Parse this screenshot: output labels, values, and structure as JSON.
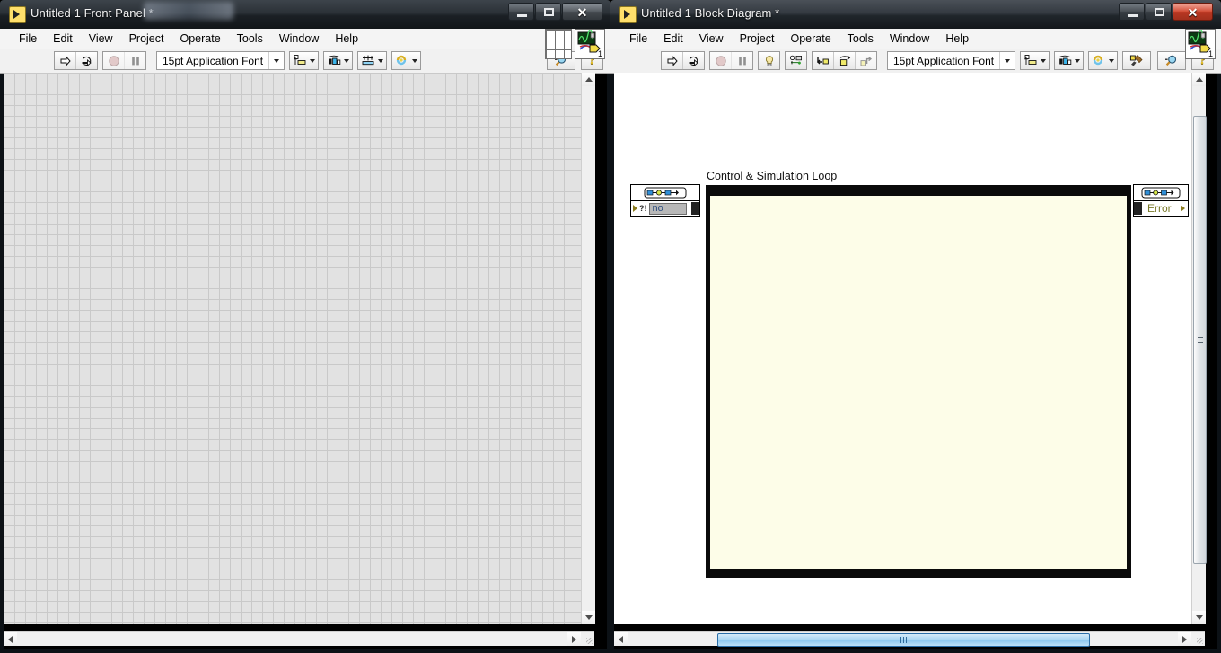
{
  "app": "LabVIEW",
  "windows": {
    "front_panel": {
      "title": "Untitled 1 Front Panel *",
      "active": false,
      "icon": "labview-vi-icon",
      "window_buttons": {
        "minimize": "–",
        "maximize": "□",
        "close": "✕"
      },
      "menus": [
        "File",
        "Edit",
        "View",
        "Project",
        "Operate",
        "Tools",
        "Window",
        "Help"
      ],
      "toolbar": {
        "font_selector": "15pt Application Font",
        "buttons": [
          {
            "name": "run-button",
            "icon": "run-arrow-icon",
            "enabled": true
          },
          {
            "name": "run-continuously-button",
            "icon": "run-continuously-icon",
            "enabled": true
          },
          {
            "name": "abort-execution-button",
            "icon": "abort-stop-icon",
            "enabled": false
          },
          {
            "name": "pause-button",
            "icon": "pause-icon",
            "enabled": false
          },
          {
            "name": "text-settings-button",
            "icon": "text-settings-icon",
            "enabled": true
          },
          {
            "name": "align-objects-button",
            "icon": "align-objects-icon",
            "enabled": true
          },
          {
            "name": "distribute-objects-button",
            "icon": "distribute-objects-icon",
            "enabled": true
          },
          {
            "name": "resize-objects-button",
            "icon": "resize-objects-icon",
            "enabled": true
          },
          {
            "name": "reorder-button",
            "icon": "reorder-icon",
            "enabled": true
          },
          {
            "name": "search-button",
            "icon": "magnifier-icon",
            "enabled": true
          },
          {
            "name": "context-help-button",
            "icon": "question-mark-icon",
            "enabled": true
          }
        ],
        "connector_pane": {
          "name": "connector-pane",
          "vi_icon": "waveform-vi-icon",
          "revision": "1"
        }
      },
      "canvas": {
        "type": "front-panel-grid",
        "background": "#e2e2e2",
        "grid_color": "#c9c9c9",
        "grid_size": 12
      },
      "scrollbars": {
        "vertical_thumb": false,
        "horizontal_thumb": false
      }
    },
    "block_diagram": {
      "title": "Untitled 1 Block Diagram *",
      "active": true,
      "icon": "labview-vi-icon",
      "window_buttons": {
        "minimize": "–",
        "maximize": "□",
        "close": "✕"
      },
      "menus": [
        "File",
        "Edit",
        "View",
        "Project",
        "Operate",
        "Tools",
        "Window",
        "Help"
      ],
      "toolbar": {
        "font_selector": "15pt Application Font",
        "buttons": [
          {
            "name": "run-button",
            "icon": "run-arrow-icon",
            "enabled": true
          },
          {
            "name": "run-continuously-button",
            "icon": "run-continuously-icon",
            "enabled": true
          },
          {
            "name": "abort-execution-button",
            "icon": "abort-stop-icon",
            "enabled": false
          },
          {
            "name": "pause-button",
            "icon": "pause-icon",
            "enabled": false
          },
          {
            "name": "highlight-execution-button",
            "icon": "lightbulb-icon",
            "enabled": true
          },
          {
            "name": "retain-wire-values-button",
            "icon": "retain-wire-values-icon",
            "enabled": true
          },
          {
            "name": "step-into-button",
            "icon": "step-into-icon",
            "enabled": true
          },
          {
            "name": "step-over-button",
            "icon": "step-over-icon",
            "enabled": true
          },
          {
            "name": "step-out-button",
            "icon": "step-out-icon",
            "enabled": false
          },
          {
            "name": "align-objects-button",
            "icon": "align-objects-icon",
            "enabled": true
          },
          {
            "name": "distribute-objects-button",
            "icon": "distribute-objects-icon",
            "enabled": true
          },
          {
            "name": "reorder-button",
            "icon": "reorder-icon",
            "enabled": true
          },
          {
            "name": "clean-up-diagram-button",
            "icon": "clean-up-diagram-icon",
            "enabled": true
          },
          {
            "name": "search-button",
            "icon": "magnifier-icon",
            "enabled": true
          },
          {
            "name": "context-help-button",
            "icon": "question-mark-icon",
            "enabled": true
          }
        ],
        "connector_pane": {
          "name": "connector-pane",
          "vi_icon": "waveform-vi-icon",
          "revision": "1"
        }
      },
      "canvas": {
        "type": "block-diagram",
        "background": "#ffffff"
      },
      "diagram": {
        "structure": {
          "name": "control-and-simulation-loop",
          "label": "Control & Simulation Loop",
          "border_color": "#0a0a0a",
          "fill_color": "#fdfde8"
        },
        "input_node": {
          "name": "simulation-parameters-node",
          "config_icon": "input-node-config-icon",
          "value": "no",
          "indicator": "halt-terminal"
        },
        "output_node": {
          "name": "simulation-error-node",
          "config_icon": "output-node-config-icon",
          "label": "Error"
        }
      },
      "scrollbars": {
        "vertical_thumb": true,
        "horizontal_thumb": true
      }
    }
  }
}
